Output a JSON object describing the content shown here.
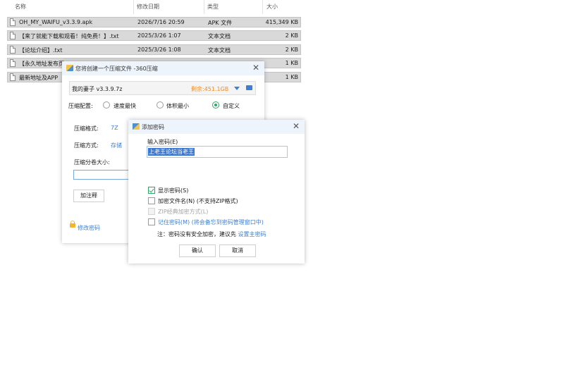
{
  "explorer": {
    "columns": [
      "名称",
      "修改日期",
      "类型",
      "大小"
    ],
    "sort_indicator": "^",
    "files": [
      {
        "name": "OH_MY_WAIFU_v3.3.9.apk",
        "date": "2026/7/16 20:59",
        "type": "APK 文件",
        "size": "415,349 KB"
      },
      {
        "name": "【来了就能下载和观看！纯免费！】.txt",
        "date": "2025/3/26 1:07",
        "type": "文本文档",
        "size": "2 KB"
      },
      {
        "name": "【论坛介绍】.txt",
        "date": "2025/3/26 1:08",
        "type": "文本文档",
        "size": "2 KB"
      },
      {
        "name": "【永久地址发布页",
        "date": "",
        "type": "",
        "size": "1 KB"
      },
      {
        "name": "最新地址及APP",
        "date": "",
        "type": "",
        "size": "1 KB"
      }
    ]
  },
  "compress_dialog": {
    "title": "您将创建一个压缩文件 -360压缩",
    "archive_name": "我的妻子 v3.3.9.7z",
    "free_space": "剩余:451.1GB",
    "config_label": "压缩配置:",
    "modes": [
      "速度最快",
      "体积最小",
      "自定义"
    ],
    "selected_mode": "自定义",
    "format_label": "压缩格式:",
    "format_value": "7Z",
    "method_label": "压缩方式:",
    "method_value": "存储",
    "split_label": "压缩分卷大小:",
    "note_button": "加注释",
    "password_link": "修改密码",
    "close_glyph": "✕"
  },
  "password_dialog": {
    "title": "添加密码",
    "close_glyph": "✕",
    "input_label": "输入密码(E)",
    "password_value": "上老王论坛当老王",
    "options": [
      {
        "label": "显示密码(S)",
        "checked": true,
        "disabled": false
      },
      {
        "label": "加密文件名(N) (不支持ZIP格式)",
        "checked": false,
        "disabled": false
      },
      {
        "label": "ZIP经典加密方式(L)",
        "checked": false,
        "disabled": true
      },
      {
        "label": "记住密码(M) (将会备忘到密码管理窗口中)",
        "checked": false,
        "disabled": false
      }
    ],
    "note_prefix": "注：密码没有安全加密，建议先",
    "note_link": "设置主密码",
    "ok_button": "确认",
    "cancel_button": "取消"
  },
  "colors": {
    "accent": "#3c7fd6",
    "free_space": "#f08a1c",
    "check": "#2fa56a",
    "selection": "#d9d9d9"
  }
}
